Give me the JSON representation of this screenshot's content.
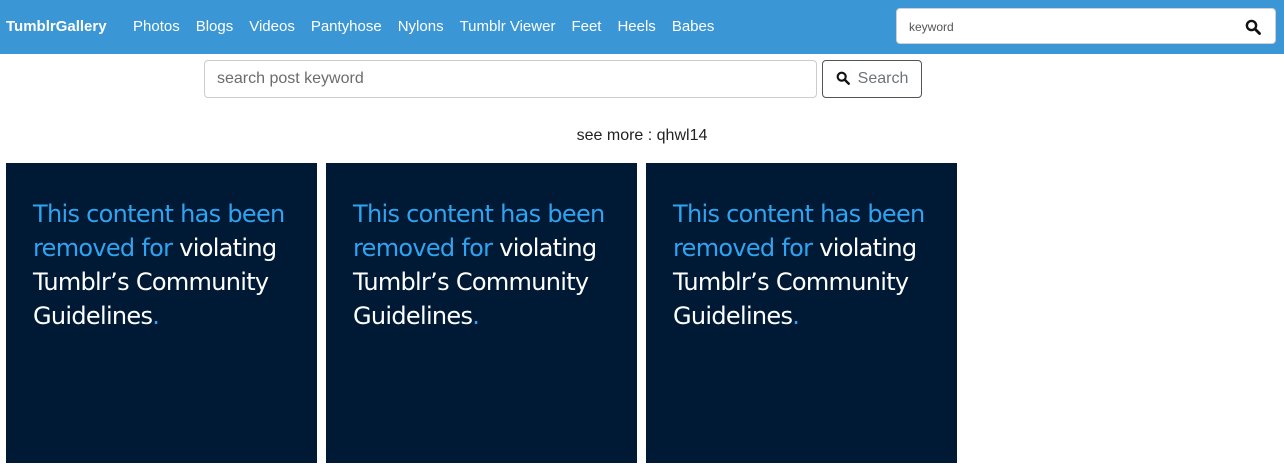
{
  "navbar": {
    "brand": "TumblrGallery",
    "links": [
      "Photos",
      "Blogs",
      "Videos",
      "Pantyhose",
      "Nylons",
      "Tumblr Viewer",
      "Feet",
      "Heels",
      "Babes"
    ],
    "search": {
      "placeholder": "keyword"
    },
    "color": "#3a96d4"
  },
  "post_search": {
    "placeholder": "search post keyword",
    "button_label": "Search"
  },
  "see_more": {
    "prefix": "see more : ",
    "link": "qhwl14"
  },
  "cards": [
    {
      "line_highlight": "This content has been removed for",
      "line_rest": " violating Tumblr’s Community Guidelines",
      "dot": "."
    },
    {
      "line_highlight": "This content has been removed for",
      "line_rest": " violating Tumblr’s Community Guidelines",
      "dot": "."
    },
    {
      "line_highlight": "This content has been removed for",
      "line_rest": " violating Tumblr’s Community Guidelines",
      "dot": "."
    }
  ],
  "colors": {
    "card_bg": "#001935",
    "highlight": "#2fa4f0"
  }
}
